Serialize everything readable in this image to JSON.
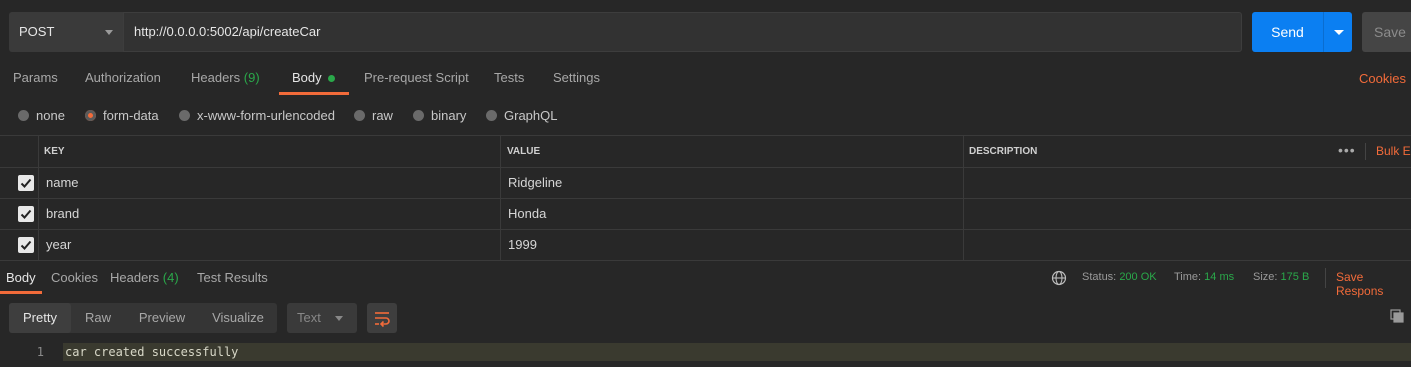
{
  "request": {
    "method": "POST",
    "url": "http://0.0.0.0:5002/api/createCar",
    "send_label": "Send",
    "save_label": "Save"
  },
  "request_tabs": [
    {
      "label": "Params"
    },
    {
      "label": "Authorization"
    },
    {
      "label": "Headers",
      "count": "(9)"
    },
    {
      "label": "Body",
      "active": true
    },
    {
      "label": "Pre-request Script"
    },
    {
      "label": "Tests"
    },
    {
      "label": "Settings"
    }
  ],
  "cookies_label": "Cookies",
  "body_types": [
    {
      "label": "none"
    },
    {
      "label": "form-data",
      "selected": true
    },
    {
      "label": "x-www-form-urlencoded"
    },
    {
      "label": "raw"
    },
    {
      "label": "binary"
    },
    {
      "label": "GraphQL"
    }
  ],
  "table": {
    "headers": {
      "key": "KEY",
      "value": "VALUE",
      "description": "DESCRIPTION",
      "bulk_edit": "Bulk E"
    },
    "rows": [
      {
        "key": "name",
        "value": "Ridgeline",
        "description": "",
        "checked": true
      },
      {
        "key": "brand",
        "value": "Honda",
        "description": "",
        "checked": true
      },
      {
        "key": "year",
        "value": "1999",
        "description": "",
        "checked": true
      }
    ]
  },
  "response": {
    "tabs": [
      {
        "label": "Body",
        "active": true
      },
      {
        "label": "Cookies"
      },
      {
        "label": "Headers",
        "count": "(4)"
      },
      {
        "label": "Test Results"
      }
    ],
    "status_label": "Status:",
    "status_value": "200 OK",
    "time_label": "Time:",
    "time_value": "14 ms",
    "size_label": "Size:",
    "size_value": "175 B",
    "save_response": "Save Respons",
    "views": [
      "Pretty",
      "Raw",
      "Preview",
      "Visualize"
    ],
    "format": "Text",
    "line_number": "1",
    "body_text": "car created successfully"
  },
  "colors": {
    "accent": "#f26b3a",
    "send": "#0b7ff2",
    "success": "#2aa84a"
  }
}
